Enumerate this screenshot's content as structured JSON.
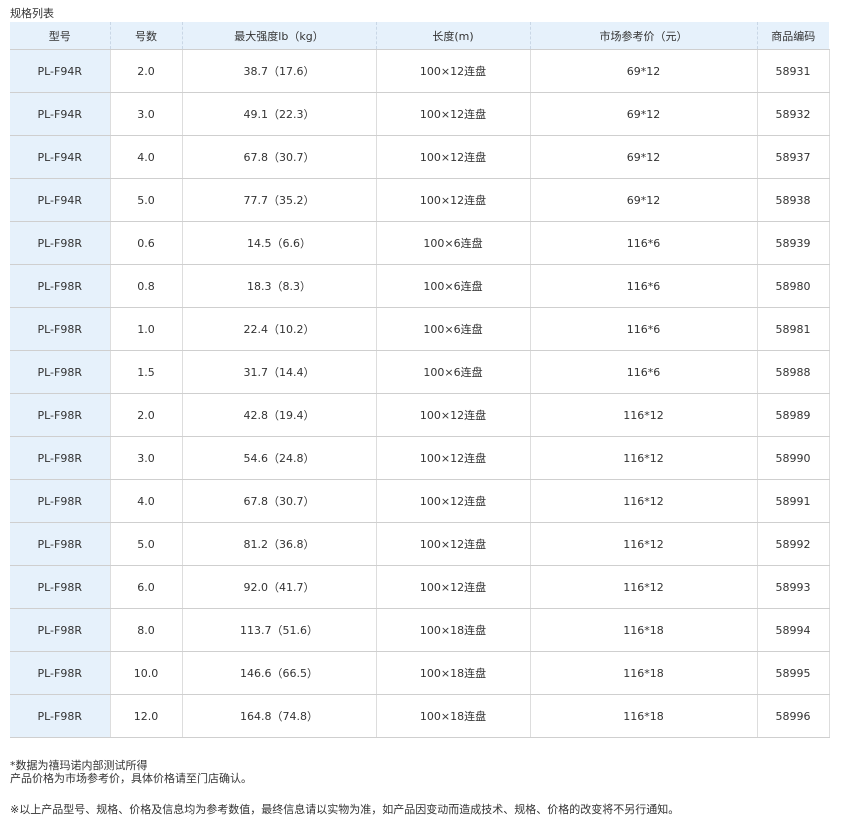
{
  "section_title": "规格列表",
  "table": {
    "headers": [
      "型号",
      "号数",
      "最大强度lb（kg）",
      "长度(m)",
      "市场参考价（元）",
      "商品编码"
    ],
    "rows": [
      [
        "PL-F94R",
        "2.0",
        "38.7（17.6）",
        "100×12连盘",
        "69*12",
        "58931"
      ],
      [
        "PL-F94R",
        "3.0",
        "49.1（22.3）",
        "100×12连盘",
        "69*12",
        "58932"
      ],
      [
        "PL-F94R",
        "4.0",
        "67.8（30.7）",
        "100×12连盘",
        "69*12",
        "58937"
      ],
      [
        "PL-F94R",
        "5.0",
        "77.7（35.2）",
        "100×12连盘",
        "69*12",
        "58938"
      ],
      [
        "PL-F98R",
        "0.6",
        "14.5（6.6）",
        "100×6连盘",
        "116*6",
        "58939"
      ],
      [
        "PL-F98R",
        "0.8",
        "18.3（8.3）",
        "100×6连盘",
        "116*6",
        "58980"
      ],
      [
        "PL-F98R",
        "1.0",
        "22.4（10.2）",
        "100×6连盘",
        "116*6",
        "58981"
      ],
      [
        "PL-F98R",
        "1.5",
        "31.7（14.4）",
        "100×6连盘",
        "116*6",
        "58988"
      ],
      [
        "PL-F98R",
        "2.0",
        "42.8（19.4）",
        "100×12连盘",
        "116*12",
        "58989"
      ],
      [
        "PL-F98R",
        "3.0",
        "54.6（24.8）",
        "100×12连盘",
        "116*12",
        "58990"
      ],
      [
        "PL-F98R",
        "4.0",
        "67.8（30.7）",
        "100×12连盘",
        "116*12",
        "58991"
      ],
      [
        "PL-F98R",
        "5.0",
        "81.2（36.8）",
        "100×12连盘",
        "116*12",
        "58992"
      ],
      [
        "PL-F98R",
        "6.0",
        "92.0（41.7）",
        "100×12连盘",
        "116*12",
        "58993"
      ],
      [
        "PL-F98R",
        "8.0",
        "113.7（51.6）",
        "100×18连盘",
        "116*18",
        "58994"
      ],
      [
        "PL-F98R",
        "10.0",
        "146.6（66.5）",
        "100×18连盘",
        "116*18",
        "58995"
      ],
      [
        "PL-F98R",
        "12.0",
        "164.8（74.8）",
        "100×18连盘",
        "116*18",
        "58996"
      ]
    ]
  },
  "footnotes": {
    "line1": "*数据为禧玛诺内部测试所得",
    "line2": "产品价格为市场参考价，具体价格请至门店确认。",
    "line3": "※以上产品型号、规格、价格及信息均为参考数值，最终信息请以实物为准，如产品因变动而造成技术、规格、价格的改变将不另行通知。"
  }
}
